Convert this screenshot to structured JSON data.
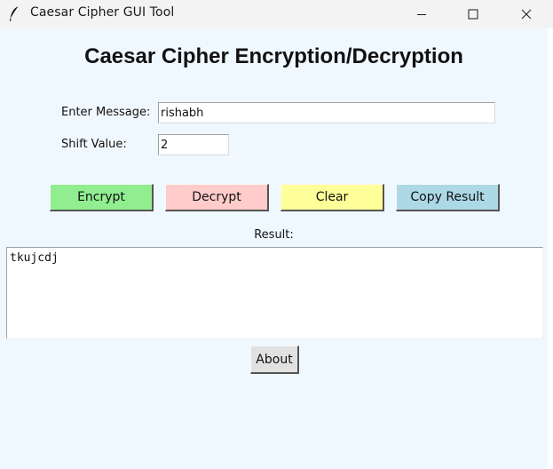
{
  "window": {
    "title": "Caesar Cipher GUI Tool",
    "icon": "feather-icon",
    "controls": [
      "minimize-icon",
      "maximize-icon",
      "close-icon"
    ]
  },
  "heading": "Caesar Cipher Encryption/Decryption",
  "form": {
    "message_label": "Enter Message:",
    "message_value": "rishabh",
    "shift_label": "Shift Value:",
    "shift_value": "2"
  },
  "buttons": {
    "encrypt": "Encrypt",
    "decrypt": "Decrypt",
    "clear": "Clear",
    "copy": "Copy Result",
    "about": "About"
  },
  "result": {
    "label": "Result:",
    "text": "tkujcdj"
  },
  "colors": {
    "background": "#f0f8ff",
    "encrypt": "#90ee90",
    "decrypt": "#ffcccb",
    "clear": "#ffff99",
    "copy": "#add8e6"
  }
}
